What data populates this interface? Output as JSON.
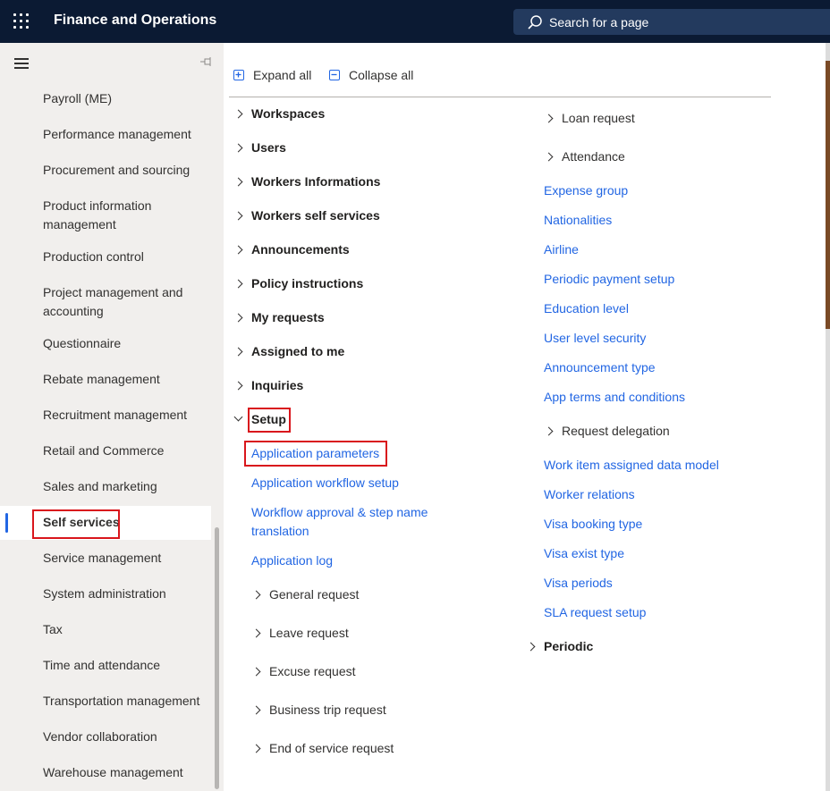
{
  "app": {
    "title": "Finance and Operations"
  },
  "search": {
    "placeholder": "Search for a page"
  },
  "colors": {
    "topbar": "#0b1a33",
    "accent": "#2266e3",
    "highlight": "#d9161c"
  },
  "toolbar": {
    "expand_all": "Expand all",
    "collapse_all": "Collapse all"
  },
  "nav": {
    "items": [
      "Payroll (ME)",
      "Performance management",
      "Procurement and sourcing",
      "Product information management",
      "Production control",
      "Project management and accounting",
      "Questionnaire",
      "Rebate management",
      "Recruitment management",
      "Retail and Commerce",
      "Sales and marketing",
      "Self services",
      "Service management",
      "System administration",
      "Tax",
      "Time and attendance",
      "Transportation management",
      "Vendor collaboration",
      "Warehouse management"
    ],
    "selected": "Self services"
  },
  "menu": {
    "groups": [
      "Workspaces",
      "Users",
      "Workers Informations",
      "Workers self services",
      "Announcements",
      "Policy instructions",
      "My requests",
      "Assigned to me",
      "Inquiries"
    ],
    "setup": {
      "label": "Setup",
      "links": [
        "Application parameters",
        "Application workflow setup",
        "Workflow approval & step name translation",
        "Application log"
      ],
      "subgroups": [
        "General request",
        "Leave request",
        "Excuse request",
        "Business trip request",
        "End of service request"
      ]
    },
    "right_col": {
      "subgroups_top": [
        "Loan request",
        "Attendance"
      ],
      "links_a": [
        "Expense group",
        "Nationalities",
        "Airline",
        "Periodic payment setup",
        "Education level",
        "User level security",
        "Announcement type",
        "App terms and conditions"
      ],
      "subgroup_mid": "Request delegation",
      "links_b": [
        "Work item assigned data model",
        "Worker relations",
        "Visa booking type",
        "Visa exist type",
        "Visa periods",
        "SLA request setup"
      ],
      "periodic": "Periodic"
    }
  }
}
